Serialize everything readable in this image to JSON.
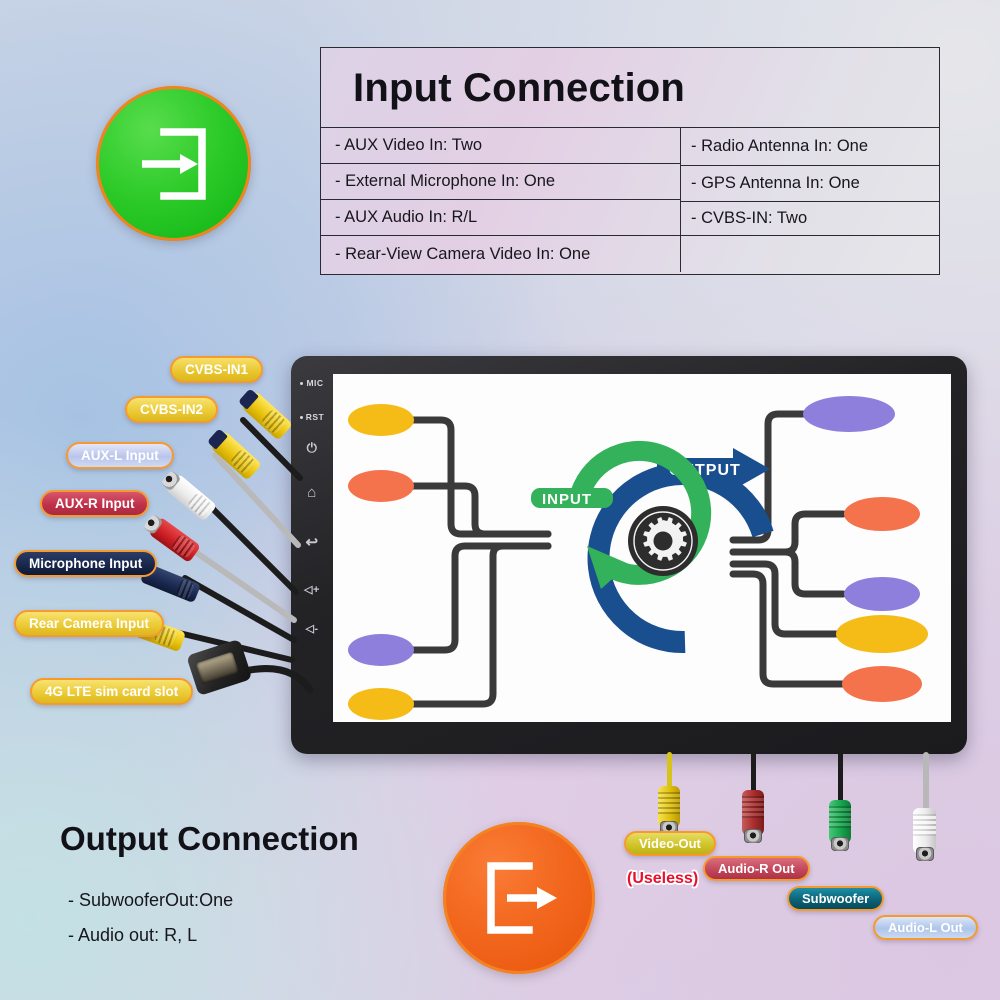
{
  "spec": {
    "title": "Input Connection",
    "left_rows": [
      "- AUX Video In: Two",
      "- External Microphone In: One",
      "- AUX Audio In: R/L",
      "- Rear-View Camera Video In: One"
    ],
    "right_rows": [
      "- Radio Antenna In: One",
      "- GPS Antenna In: One",
      "- CVBS-IN: Two"
    ]
  },
  "badges": {
    "input": {
      "icon": "login-arrow-icon",
      "color": "#1fc41f",
      "ring": "#f58220"
    },
    "output": {
      "icon": "logout-arrow-icon",
      "color": "#f2661d",
      "ring": "#f58220"
    }
  },
  "output_block": {
    "title": "Output Connection",
    "lines": [
      "- SubwooferOut:One",
      "- Audio out: R, L"
    ]
  },
  "device": {
    "side_buttons": [
      {
        "label": "MIC",
        "type": "text-dot"
      },
      {
        "label": "RST",
        "type": "text-dot"
      },
      {
        "label": "⏻",
        "type": "icon",
        "name": "power-icon"
      },
      {
        "label": "⌂",
        "type": "icon",
        "name": "home-icon"
      },
      {
        "label": "↩",
        "type": "icon",
        "name": "back-icon"
      },
      {
        "label": "◁+",
        "type": "icon",
        "name": "volume-up-icon"
      },
      {
        "label": "◁-",
        "type": "icon",
        "name": "volume-down-icon"
      }
    ],
    "diagram": {
      "input_label": "INPUT",
      "output_label": "OUTPUT",
      "center_icon": "gear-process-icon",
      "input_arc_color": "#33b25b",
      "output_arc_color": "#1a4f8f",
      "left_nodes": [
        {
          "color": "#f5bc18"
        },
        {
          "color": "#f4734d"
        },
        {
          "color": "#8d7fdb"
        },
        {
          "color": "#f5bc18"
        }
      ],
      "right_nodes": [
        {
          "color": "#8d7fdb"
        },
        {
          "color": "#f4734d"
        },
        {
          "color": "#8d7fdb"
        },
        {
          "color": "#f5bc18"
        },
        {
          "color": "#f4734d"
        }
      ]
    }
  },
  "input_labels": [
    {
      "text": "CVBS-IN1",
      "bg": "#f0cf43",
      "fg": "#ffffff"
    },
    {
      "text": "CVBS-IN2",
      "bg": "#f2d24c",
      "fg": "#ffffff"
    },
    {
      "text": "AUX-L Input",
      "bg": "#c6cef0",
      "fg": "#ffffff"
    },
    {
      "text": "AUX-R Input",
      "bg": "#c94055",
      "fg": "#ffffff"
    },
    {
      "text": "Microphone Input",
      "bg": "#1b2a52",
      "fg": "#ffffff"
    },
    {
      "text": "Rear Camera Input",
      "bg": "#f0d24d",
      "fg": "#ffffff"
    },
    {
      "text": "4G LTE sim card slot",
      "bg": "#f0d24d",
      "fg": "#ffffff"
    }
  ],
  "output_labels": [
    {
      "text": "Video-Out",
      "bg": "#d9cf3f",
      "fg": "#ffffff"
    },
    {
      "text": "Audio-R Out",
      "bg": "#c7475c",
      "fg": "#ffffff"
    },
    {
      "text": "Subwoofer",
      "bg": "#0e6f86",
      "fg": "#ffffff"
    },
    {
      "text": "Audio-L Out",
      "bg": "#bcd0ee",
      "fg": "#ffffff"
    }
  ],
  "annotations": {
    "useless": "(Useless)"
  },
  "connectors": {
    "input": [
      {
        "name": "cvbs-in1-connector",
        "color": "#f2d018"
      },
      {
        "name": "cvbs-in2-connector",
        "color": "#f2d018"
      },
      {
        "name": "aux-l-connector",
        "color": "#f2f2f2"
      },
      {
        "name": "aux-r-connector",
        "color": "#c62828"
      },
      {
        "name": "microphone-connector",
        "color": "#1b2a52"
      },
      {
        "name": "rear-camera-connector",
        "color": "#f2d018"
      },
      {
        "name": "sim-card-slot-connector",
        "color": "#2a2a2a"
      }
    ],
    "output": [
      {
        "name": "video-out-connector",
        "color": "#f2d018"
      },
      {
        "name": "audio-r-out-connector",
        "color": "#b03030"
      },
      {
        "name": "subwoofer-connector",
        "color": "#23a455"
      },
      {
        "name": "audio-l-out-connector",
        "color": "#f0f0f0"
      }
    ]
  }
}
